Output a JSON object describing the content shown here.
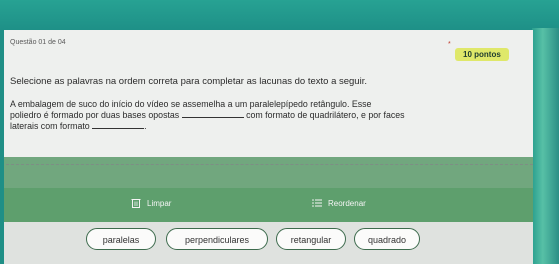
{
  "question": {
    "number_label": "Questão 01 de 04",
    "points": "10 pontos",
    "required_mark": "*"
  },
  "prompt": "Selecione as palavras na ordem correta para completar as lacunas do texto a seguir.",
  "text": {
    "line1": "A embalagem de suco do início do vídeo se assemelha a um paralelepípedo retângulo. Esse",
    "line2a": "poliedro é formado por duas bases opostas",
    "line2b": "com formato de quadrilátero, e por faces",
    "line3a": "laterais com formato",
    "line3b": "."
  },
  "actions": {
    "clear_label": "Limpar",
    "reorder_label": "Reordenar",
    "clear_icon": "trash-icon",
    "reorder_icon": "list-icon"
  },
  "options": [
    "paralelas",
    "perpendiculares",
    "retangular",
    "quadrado"
  ],
  "colors": {
    "frame": "#1f8f86",
    "card": "#eef0ee",
    "action_bar": "#5e9f6d",
    "points_badge": "#dfe86a",
    "chip_border": "#3d6b4d"
  }
}
